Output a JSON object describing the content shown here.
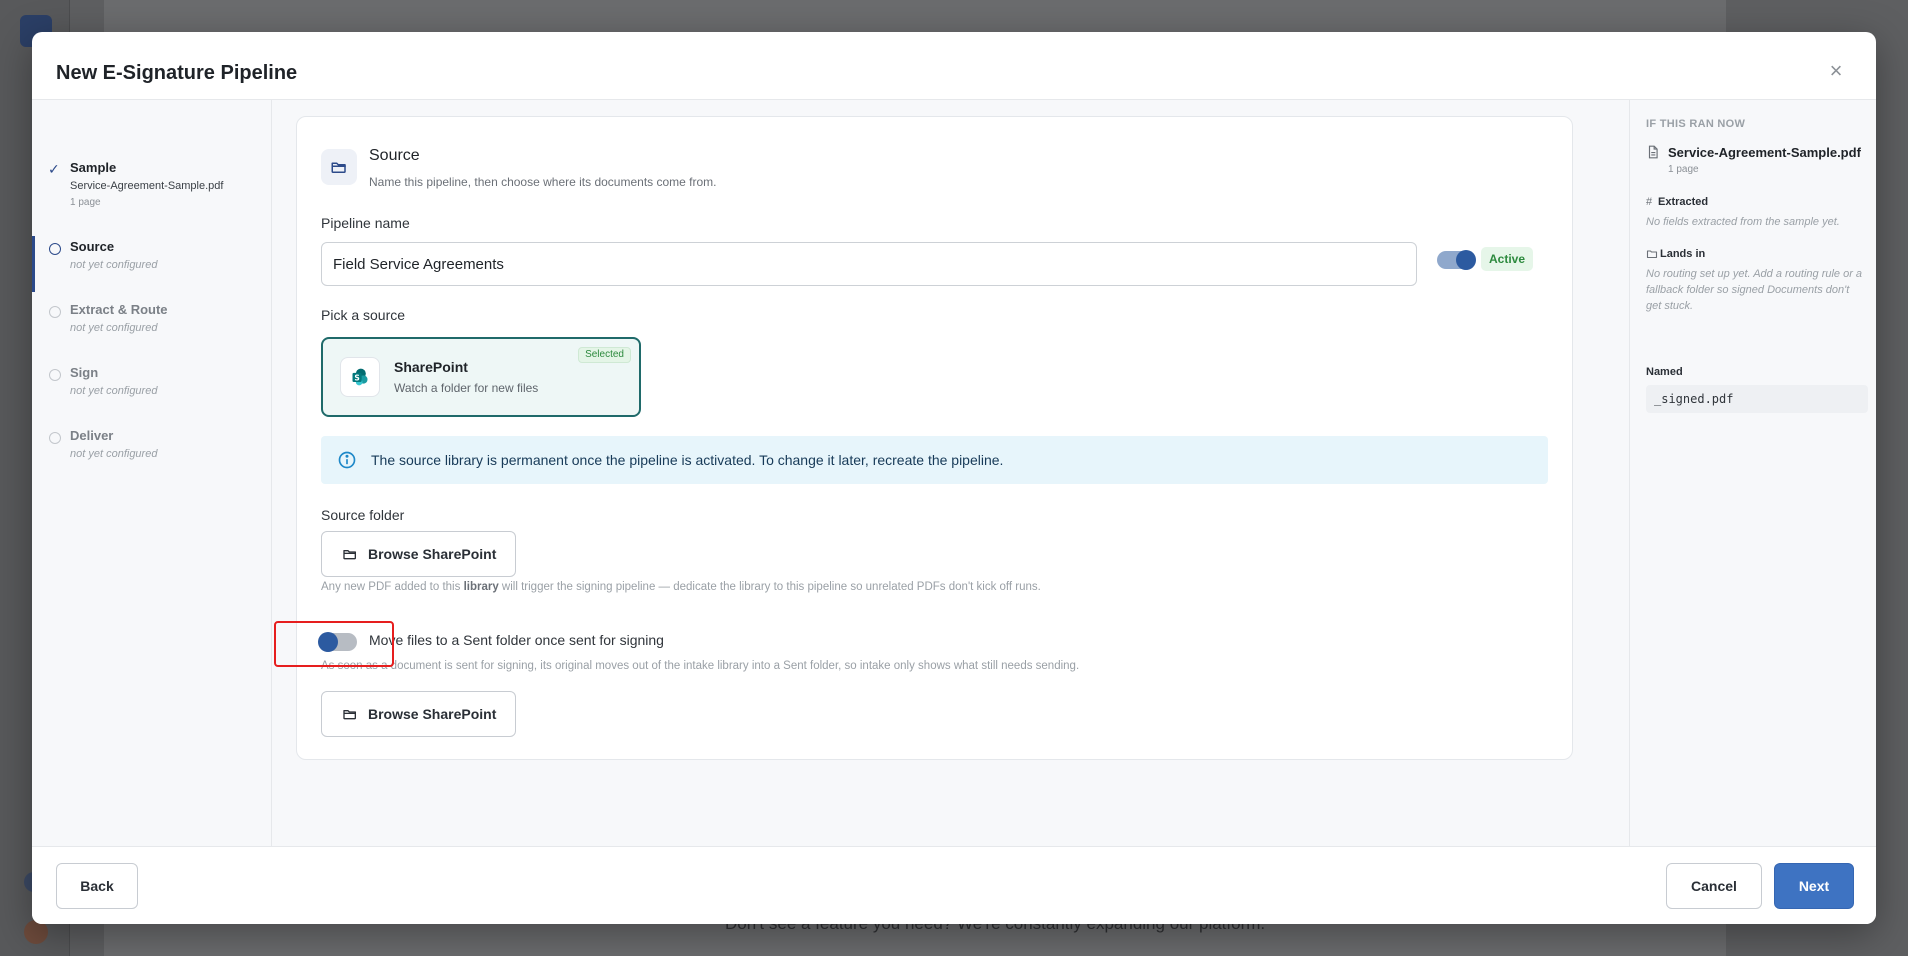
{
  "background": {
    "footer_text": "Don't see a feature you need? We're constantly expanding our platform."
  },
  "modal": {
    "title": "New E-Signature Pipeline",
    "close_label": "×"
  },
  "steps": [
    {
      "name": "Sample",
      "sub": "Service-Agreement-Sample.pdf",
      "sub2": "1 page",
      "state": "done"
    },
    {
      "name": "Source",
      "sub": "not yet configured",
      "state": "active"
    },
    {
      "name": "Extract & Route",
      "sub": "not yet configured",
      "state": "pending"
    },
    {
      "name": "Sign",
      "sub": "not yet configured",
      "state": "pending"
    },
    {
      "name": "Deliver",
      "sub": "not yet configured",
      "state": "pending"
    }
  ],
  "source": {
    "title": "Source",
    "subtitle": "Name this pipeline, then choose where its documents come from.",
    "pipeline_name_label": "Pipeline name",
    "pipeline_name_value": "Field Service Agreements",
    "active_toggle": true,
    "active_label": "Active",
    "pick_label": "Pick a source",
    "tile": {
      "name": "SharePoint",
      "sub": "Watch a folder for new files",
      "badge": "Selected"
    },
    "info": "The source library is permanent once the pipeline is activated. To change it later, recreate the pipeline.",
    "folder_label": "Source folder",
    "browse_label": "Browse SharePoint",
    "help_pre": "Any new PDF added to this ",
    "help_bold": "library",
    "help_post": " will trigger the signing pipeline — dedicate the library to this pipeline so unrelated PDFs don't kick off runs.",
    "move_toggle": false,
    "move_label": "Move files to a Sent folder once sent for signing",
    "move_help": "As soon as a document is sent for signing, its original moves out of the intake library into a Sent folder, so intake only shows what still needs sending.",
    "browse_label_2": "Browse SharePoint"
  },
  "preview": {
    "heading": "IF THIS RAN NOW",
    "file": "Service-Agreement-Sample.pdf",
    "pages": "1 page",
    "extracted_label": "Extracted",
    "extracted_note": "No fields extracted from the sample yet.",
    "lands_label": "Lands in",
    "lands_note": "No routing set up yet. Add a routing rule or a fallback folder so signed Documents don't get stuck.",
    "named_label": "Named",
    "named_value": "_signed.pdf"
  },
  "footer": {
    "back": "Back",
    "cancel": "Cancel",
    "next": "Next"
  },
  "colors": {
    "accent": "#2c5aa0",
    "next_button": "#3e73c2",
    "selected_border": "#1f6a6a",
    "highlight": "#e61e1e"
  }
}
